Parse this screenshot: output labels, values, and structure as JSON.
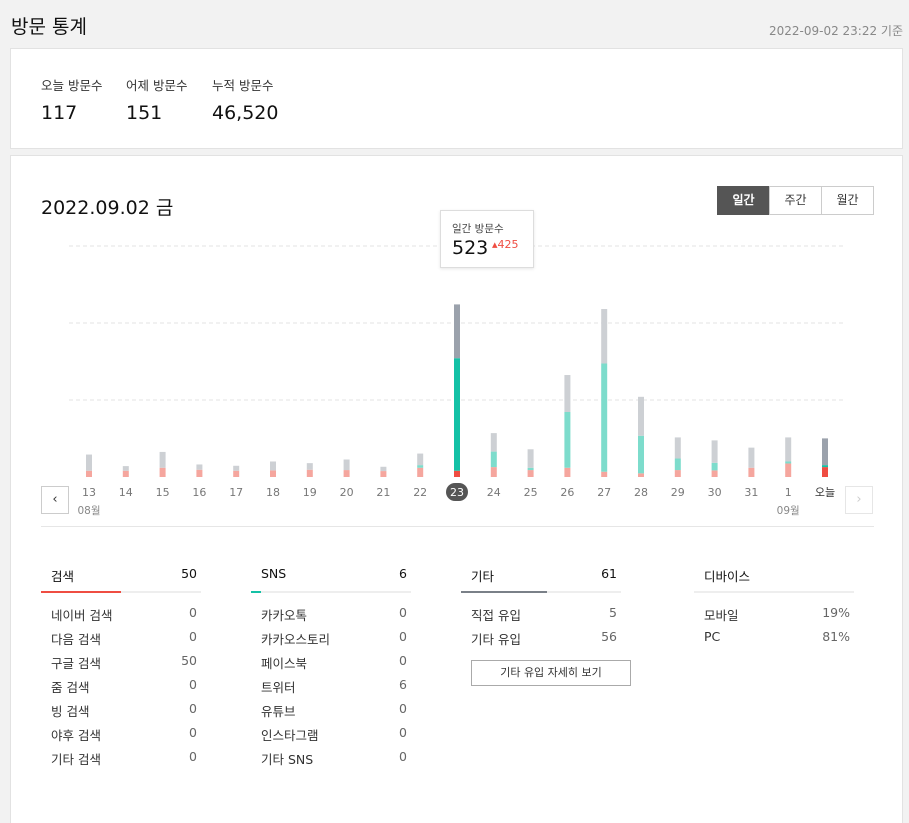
{
  "page": {
    "title": "방문 통계",
    "timestamp": "2022-09-02 23:22 기준"
  },
  "summary": [
    {
      "label": "오늘 방문수",
      "value": "117"
    },
    {
      "label": "어제 방문수",
      "value": "151"
    },
    {
      "label": "누적 방문수",
      "value": "46,520"
    }
  ],
  "date_title": "2022.09.02 금",
  "period_tabs": [
    "일간",
    "주간",
    "월간"
  ],
  "active_period": "일간",
  "tooltip": {
    "label": "일간 방문수",
    "value": "523",
    "delta": "▴425"
  },
  "nav": {
    "prev": "‹",
    "next": "›"
  },
  "colors": {
    "search": "#ef4d42",
    "sns": "#14c1a6",
    "other": "#9ba2ac",
    "accent_other": "#7a8088"
  },
  "chart_data": {
    "type": "bar",
    "stacked": true,
    "categories": [
      "13",
      "14",
      "15",
      "16",
      "17",
      "18",
      "19",
      "20",
      "21",
      "22",
      "23",
      "24",
      "25",
      "26",
      "27",
      "28",
      "29",
      "30",
      "31",
      "1",
      "오늘"
    ],
    "month_labels": [
      {
        "index": 0,
        "label": "08월"
      },
      {
        "index": 19,
        "label": "09월"
      }
    ],
    "selected_index": 10,
    "today_index": 20,
    "series": [
      {
        "key": "search",
        "values": [
          19,
          19,
          28,
          22,
          19,
          20,
          22,
          21,
          18,
          28,
          19,
          30,
          21,
          28,
          16,
          11,
          21,
          20,
          28,
          41,
          30
        ]
      },
      {
        "key": "sns",
        "values": [
          0,
          0,
          0,
          0,
          0,
          0,
          0,
          0,
          0,
          8,
          341,
          47,
          7,
          169,
          328,
          114,
          35,
          23,
          0,
          6,
          6
        ]
      },
      {
        "key": "other",
        "values": [
          49,
          14,
          48,
          16,
          15,
          27,
          20,
          32,
          13,
          35,
          163,
          56,
          56,
          112,
          165,
          118,
          64,
          68,
          61,
          73,
          81
        ]
      }
    ],
    "ylim": [
      0,
      700
    ],
    "grid": true
  },
  "stats": [
    {
      "name": "검색",
      "total": "50",
      "color": "#ef4d42",
      "rows": [
        {
          "label": "네이버 검색",
          "value": "0"
        },
        {
          "label": "다음 검색",
          "value": "0"
        },
        {
          "label": "구글 검색",
          "value": "50"
        },
        {
          "label": "줌 검색",
          "value": "0"
        },
        {
          "label": "빙 검색",
          "value": "0"
        },
        {
          "label": "야후 검색",
          "value": "0"
        },
        {
          "label": "기타 검색",
          "value": "0"
        }
      ]
    },
    {
      "name": "SNS",
      "total": "6",
      "color": "#14c1a6",
      "rows": [
        {
          "label": "카카오톡",
          "value": "0"
        },
        {
          "label": "카카오스토리",
          "value": "0"
        },
        {
          "label": "페이스북",
          "value": "0"
        },
        {
          "label": "트위터",
          "value": "6"
        },
        {
          "label": "유튜브",
          "value": "0"
        },
        {
          "label": "인스타그램",
          "value": "0"
        },
        {
          "label": "기타 SNS",
          "value": "0"
        }
      ]
    },
    {
      "name": "기타",
      "total": "61",
      "color": "#7a8088",
      "rows": [
        {
          "label": "직접 유입",
          "value": "5"
        },
        {
          "label": "기타 유입",
          "value": "56"
        }
      ],
      "button": "기타 유입 자세히 보기"
    },
    {
      "name": "디바이스",
      "total": "",
      "rows": [
        {
          "label": "모바일",
          "value": "19%"
        },
        {
          "label": "PC",
          "value": "81%"
        }
      ]
    }
  ]
}
